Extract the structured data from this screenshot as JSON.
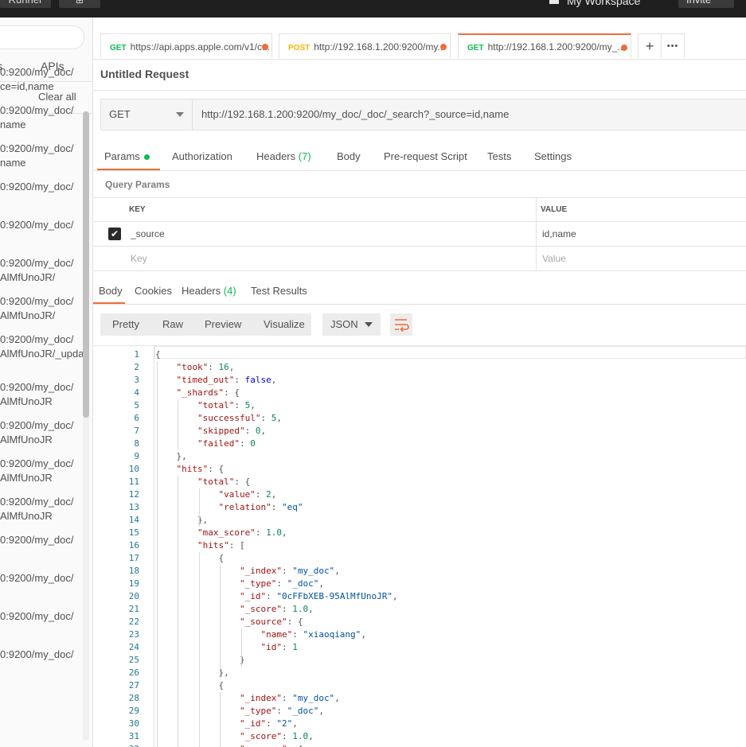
{
  "topbar": {
    "runner_label": "Runner",
    "workspace_label": "My Workspace",
    "invite_label": "Invite"
  },
  "sidebar": {
    "tab_history": "s",
    "tab_apis": "APIs",
    "clear_all": "Clear all",
    "items": [
      {
        "line1": "0:9200/my_doc/",
        "line2": "ce=id,name"
      },
      {
        "line1": "0:9200/my_doc/",
        "line2": "name"
      },
      {
        "line1": "0:9200/my_doc/",
        "line2": "name"
      },
      {
        "line1": "0:9200/my_doc/",
        "line2": ""
      },
      {
        "line1": "0:9200/my_doc/",
        "line2": ""
      },
      {
        "line1": "0:9200/my_doc/",
        "line2": "AlMfUnoJR/"
      },
      {
        "line1": "0:9200/my_doc/",
        "line2": "AlMfUnoJR/"
      },
      {
        "line1": "0:9200/my_doc/",
        "line2": "AlMfUnoJR/_upda"
      },
      {
        "line1": "0:9200/my_doc/",
        "line2": "AlMfUnoJR"
      },
      {
        "line1": "0:9200/my_doc/",
        "line2": "AlMfUnoJR"
      },
      {
        "line1": "0:9200/my_doc/",
        "line2": "AlMfUnoJR"
      },
      {
        "line1": "0:9200/my_doc/",
        "line2": "AlMfUnoJR"
      },
      {
        "line1": "0:9200/my_doc/",
        "line2": ""
      },
      {
        "line1": "0:9200/my_doc/",
        "line2": ""
      },
      {
        "line1": "0:9200/my_doc/",
        "line2": ""
      },
      {
        "line1": "0:9200/my_doc/",
        "line2": ""
      }
    ]
  },
  "request_tabs": [
    {
      "method": "GET",
      "url": "https://api.apps.apple.com/v1/c..."
    },
    {
      "method": "POST",
      "url": "http://192.168.1.200:9200/my..."
    },
    {
      "method": "GET",
      "url": "http://192.168.1.200:9200/my_..."
    }
  ],
  "tab_actions": {
    "add": "+",
    "more": "•••"
  },
  "request_title": "Untitled Request",
  "url_bar": {
    "method": "GET",
    "url": "http://192.168.1.200:9200/my_doc/_doc/_search?_source=id,name"
  },
  "sub_tabs": {
    "params": "Params",
    "authorization": "Authorization",
    "headers": "Headers",
    "headers_count": "(7)",
    "body": "Body",
    "prerequest": "Pre-request Script",
    "tests": "Tests",
    "settings": "Settings"
  },
  "query_params": {
    "title": "Query Params",
    "col_key": "KEY",
    "col_value": "VALUE",
    "rows": [
      {
        "key": "_source",
        "value": "id,name",
        "checked": true
      }
    ],
    "key_placeholder": "Key",
    "value_placeholder": "Value"
  },
  "response_tabs": {
    "body": "Body",
    "cookies": "Cookies",
    "headers": "Headers",
    "headers_count": "(4)",
    "test_results": "Test Results"
  },
  "format_bar": {
    "pretty": "Pretty",
    "raw": "Raw",
    "preview": "Preview",
    "visualize": "Visualize",
    "language": "JSON"
  },
  "code_lines": [
    "{",
    "    \"took\": 16,",
    "    \"timed_out\": false,",
    "    \"_shards\": {",
    "        \"total\": 5,",
    "        \"successful\": 5,",
    "        \"skipped\": 0,",
    "        \"failed\": 0",
    "    },",
    "    \"hits\": {",
    "        \"total\": {",
    "            \"value\": 2,",
    "            \"relation\": \"eq\"",
    "        },",
    "        \"max_score\": 1.0,",
    "        \"hits\": [",
    "            {",
    "                \"_index\": \"my_doc\",",
    "                \"_type\": \"_doc\",",
    "                \"_id\": \"0cFFbXEB-95AlMfUnoJR\",",
    "                \"_score\": 1.0,",
    "                \"_source\": {",
    "                    \"name\": \"xiaoqiang\",",
    "                    \"id\": 1",
    "                }",
    "            },",
    "            {",
    "                \"_index\": \"my_doc\",",
    "                \"_type\": \"_doc\",",
    "                \"_id\": \"2\",",
    "                \"_score\": 1.0,",
    "                \"_source\": {"
  ],
  "colors": {
    "accent": "#f26b3a",
    "get": "#0cbb52",
    "post": "#ffb400"
  }
}
